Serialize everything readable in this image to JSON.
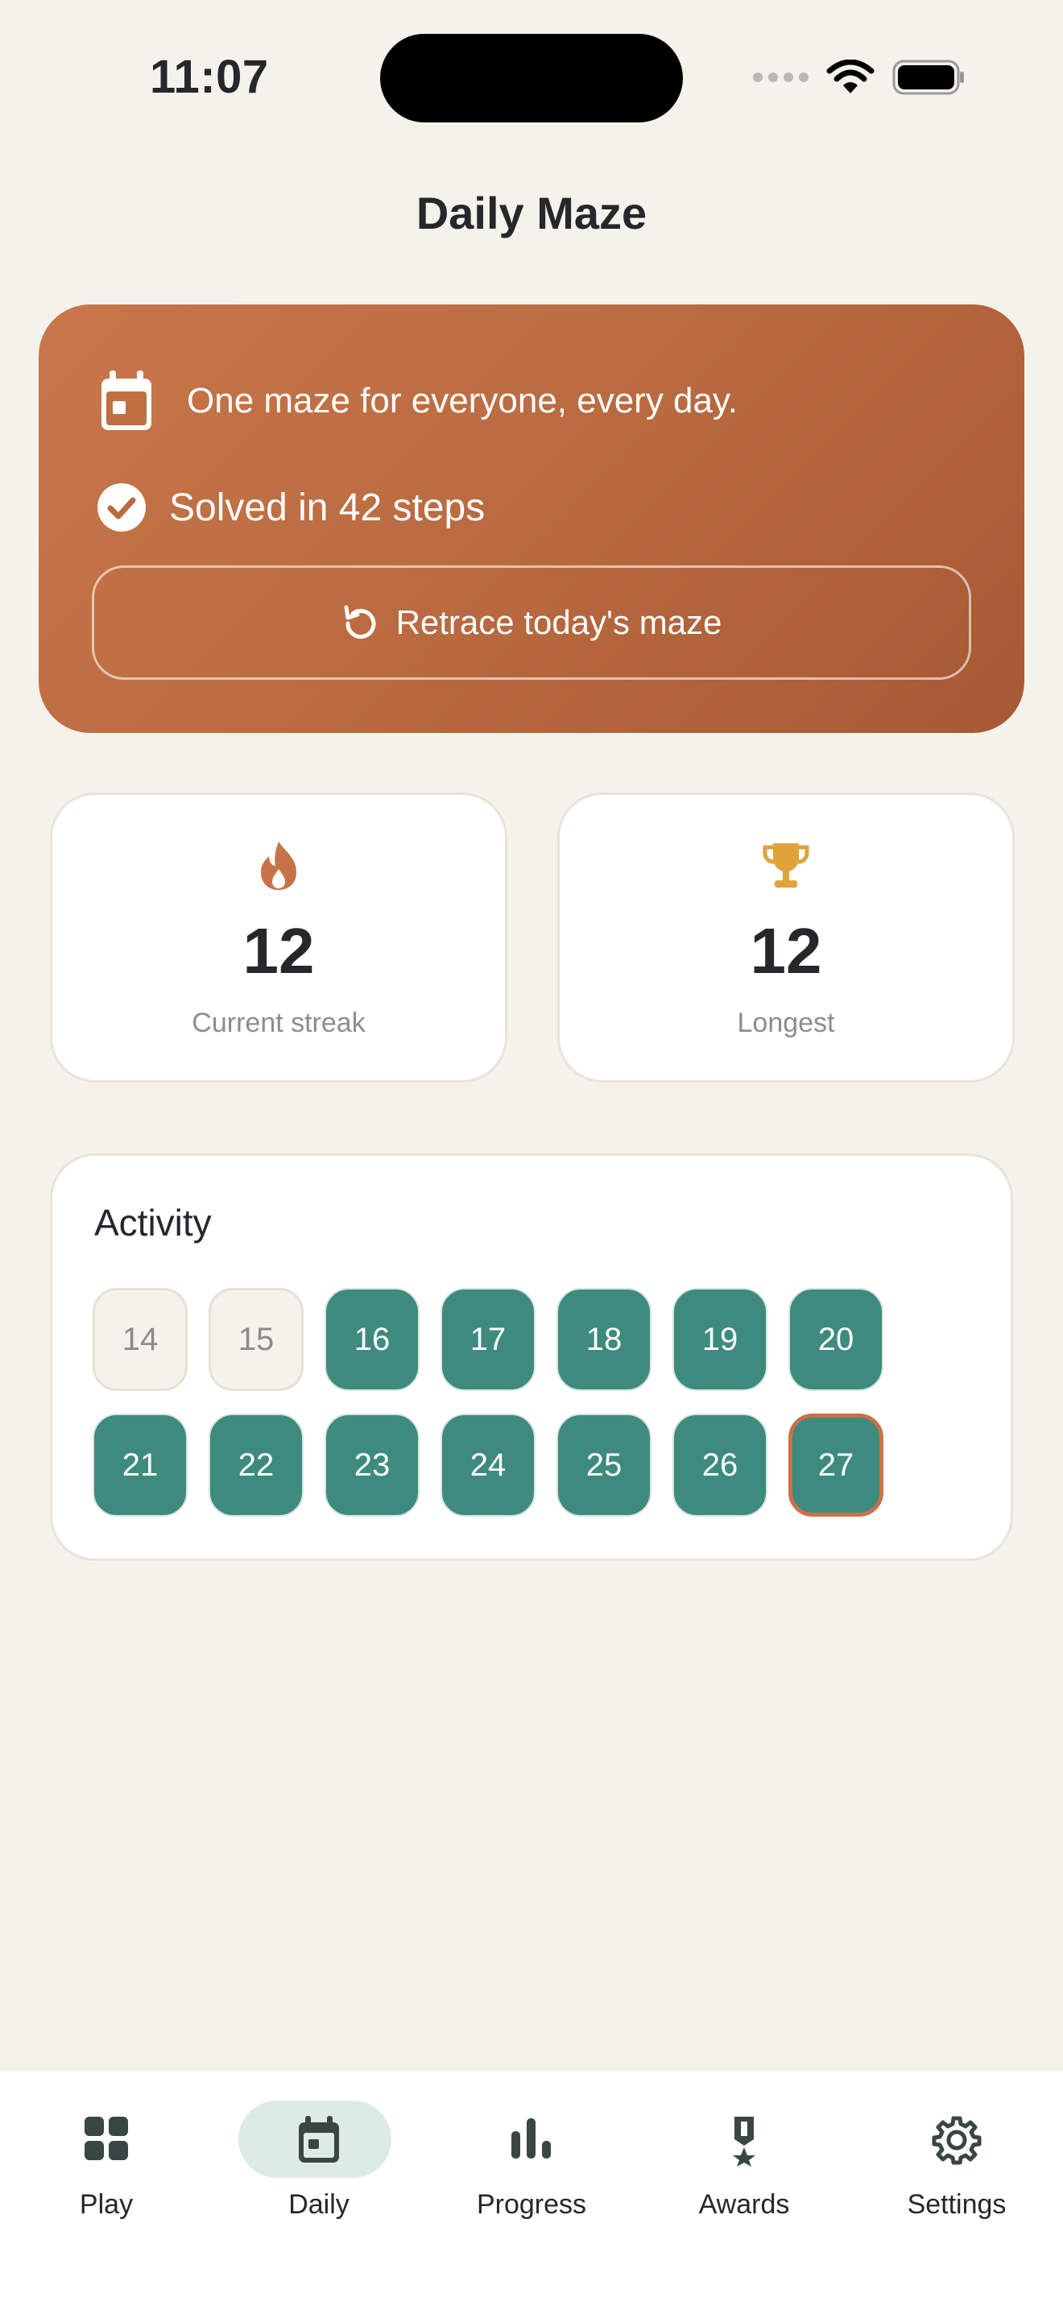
{
  "status_bar": {
    "time": "11:07"
  },
  "header": {
    "title": "Daily Maze"
  },
  "hero": {
    "tagline": "One maze for everyone, every day.",
    "solved_text": "Solved in 42 steps",
    "retrace_label": "Retrace today's maze"
  },
  "stats": {
    "current": {
      "value": "12",
      "label": "Current streak",
      "icon": "flame-icon"
    },
    "longest": {
      "value": "12",
      "label": "Longest",
      "icon": "trophy-icon"
    }
  },
  "activity": {
    "title": "Activity",
    "days": [
      {
        "label": "14",
        "status": "missed"
      },
      {
        "label": "15",
        "status": "missed"
      },
      {
        "label": "16",
        "status": "done"
      },
      {
        "label": "17",
        "status": "done"
      },
      {
        "label": "18",
        "status": "done"
      },
      {
        "label": "19",
        "status": "done"
      },
      {
        "label": "20",
        "status": "done"
      },
      {
        "label": "21",
        "status": "done"
      },
      {
        "label": "22",
        "status": "done"
      },
      {
        "label": "23",
        "status": "done"
      },
      {
        "label": "24",
        "status": "done"
      },
      {
        "label": "25",
        "status": "done"
      },
      {
        "label": "26",
        "status": "done"
      },
      {
        "label": "27",
        "status": "today"
      }
    ]
  },
  "tabs": [
    {
      "label": "Play",
      "icon": "grid-icon",
      "active": false
    },
    {
      "label": "Daily",
      "icon": "calendar-icon",
      "active": true
    },
    {
      "label": "Progress",
      "icon": "bar-chart-icon",
      "active": false
    },
    {
      "label": "Awards",
      "icon": "medal-icon",
      "active": false
    },
    {
      "label": "Settings",
      "icon": "gear-icon",
      "active": false
    }
  ],
  "colors": {
    "background": "#F5F2EC",
    "hero_start": "#C9774A",
    "hero_end": "#A75934",
    "teal": "#3F8A7E",
    "accent_orange": "#C87248",
    "trophy": "#E0A33A",
    "tab_active_pill": "#DDEBE7"
  }
}
